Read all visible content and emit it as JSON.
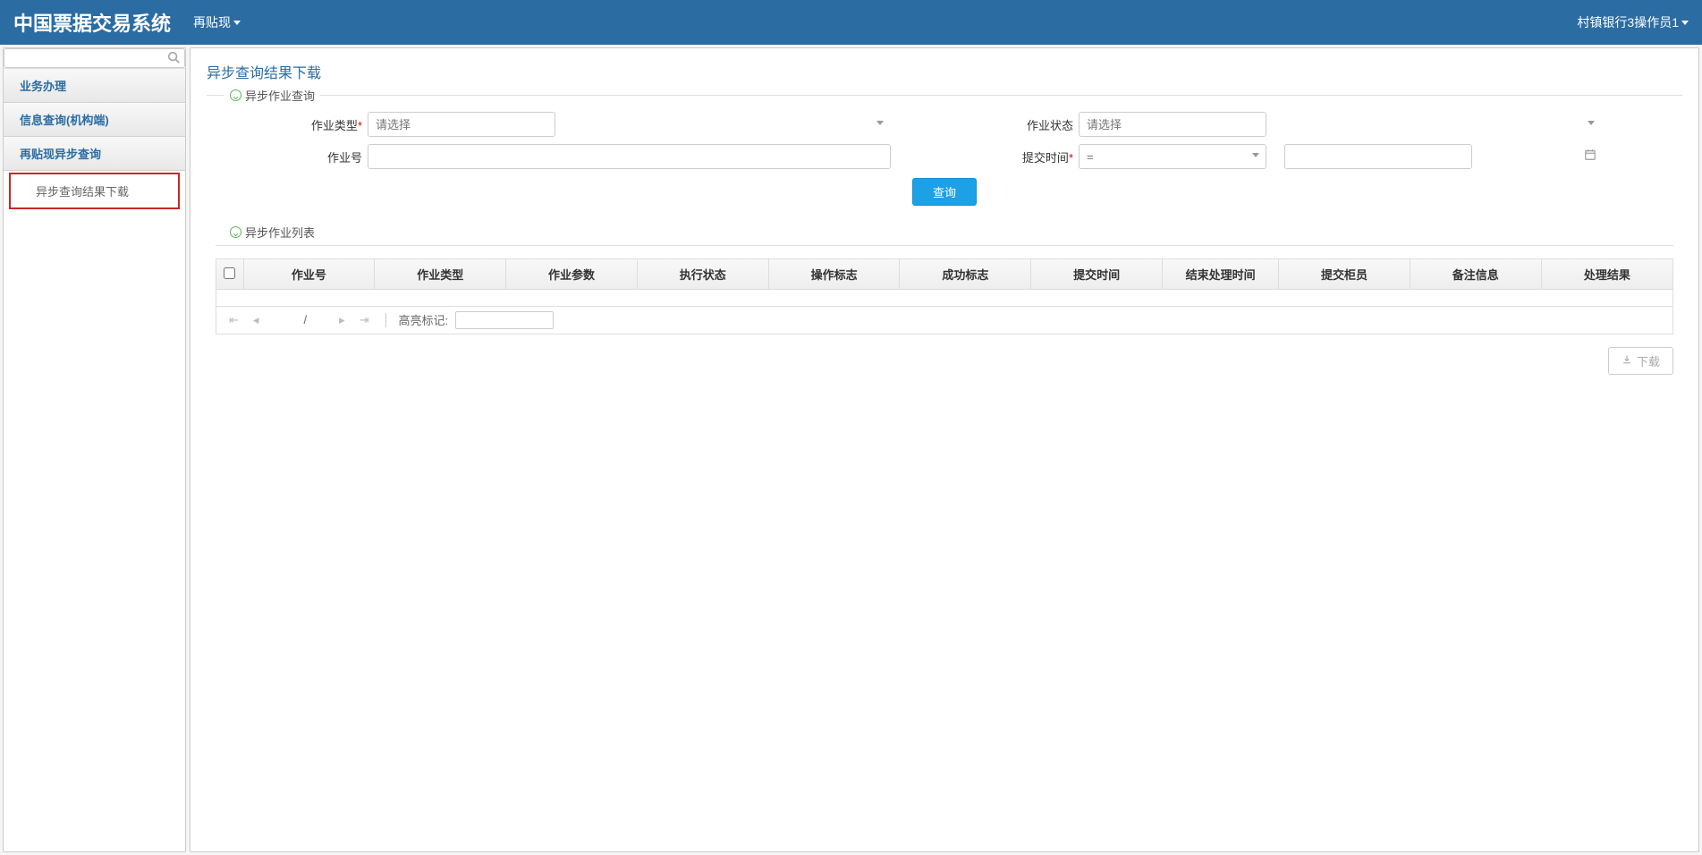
{
  "header": {
    "title": "中国票据交易系统",
    "menu": "再贴现",
    "user": "村镇银行3操作员1"
  },
  "sidebar": {
    "search_placeholder": "",
    "items": [
      {
        "label": "业务办理"
      },
      {
        "label": "信息查询(机构端)"
      },
      {
        "label": "再贴现异步查询"
      }
    ],
    "sub_selected": "异步查询结果下载"
  },
  "page": {
    "title": "异步查询结果下载",
    "section_query": "异步作业查询",
    "section_list": "异步作业列表",
    "labels": {
      "job_type": "作业类型",
      "job_no": "作业号",
      "job_status": "作业状态",
      "submit_time": "提交时间"
    },
    "placeholders": {
      "select": "请选择",
      "eq": "="
    },
    "buttons": {
      "query": "查询",
      "download": "下载"
    },
    "columns": [
      "作业号",
      "作业类型",
      "作业参数",
      "执行状态",
      "操作标志",
      "成功标志",
      "提交时间",
      "结束处理时间",
      "提交柜员",
      "备注信息",
      "处理结果"
    ],
    "pager": {
      "slash": "/",
      "highlight_label": "高亮标记:"
    }
  }
}
